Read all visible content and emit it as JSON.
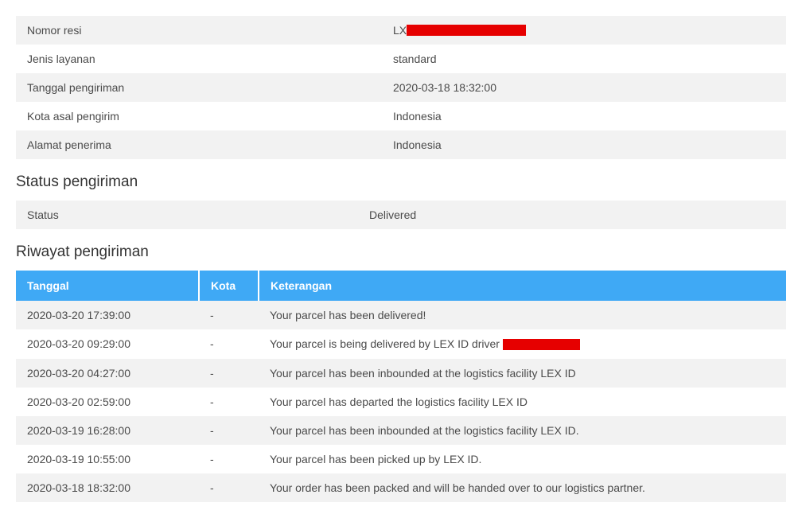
{
  "info": {
    "rows": [
      {
        "label": "Nomor resi",
        "value_prefix": "LX",
        "redact_width": 150
      },
      {
        "label": "Jenis layanan",
        "value": "standard"
      },
      {
        "label": "Tanggal pengiriman",
        "value": "2020-03-18 18:32:00"
      },
      {
        "label": "Kota asal pengirim",
        "value": "Indonesia"
      },
      {
        "label": "Alamat penerima",
        "value": "Indonesia"
      }
    ]
  },
  "status": {
    "heading": "Status pengiriman",
    "label": "Status",
    "value": "Delivered"
  },
  "history": {
    "heading": "Riwayat pengiriman",
    "columns": {
      "date": "Tanggal",
      "city": "Kota",
      "desc": "Keterangan"
    },
    "rows": [
      {
        "date": "2020-03-20 17:39:00",
        "city": "-",
        "desc": "Your parcel has been delivered!"
      },
      {
        "date": "2020-03-20 09:29:00",
        "city": "-",
        "desc_prefix": "Your parcel is being delivered by LEX ID driver ",
        "redact_width": 97
      },
      {
        "date": "2020-03-20 04:27:00",
        "city": "-",
        "desc": "Your parcel has been inbounded at the logistics facility LEX ID"
      },
      {
        "date": "2020-03-20 02:59:00",
        "city": "-",
        "desc": "Your parcel has departed the logistics facility LEX ID"
      },
      {
        "date": "2020-03-19 16:28:00",
        "city": "-",
        "desc": "Your parcel has been inbounded at the logistics facility LEX ID."
      },
      {
        "date": "2020-03-19 10:55:00",
        "city": "-",
        "desc": "Your parcel has been picked up by LEX ID."
      },
      {
        "date": "2020-03-18 18:32:00",
        "city": "-",
        "desc": "Your order has been packed and will be handed over to our logistics partner."
      }
    ]
  }
}
